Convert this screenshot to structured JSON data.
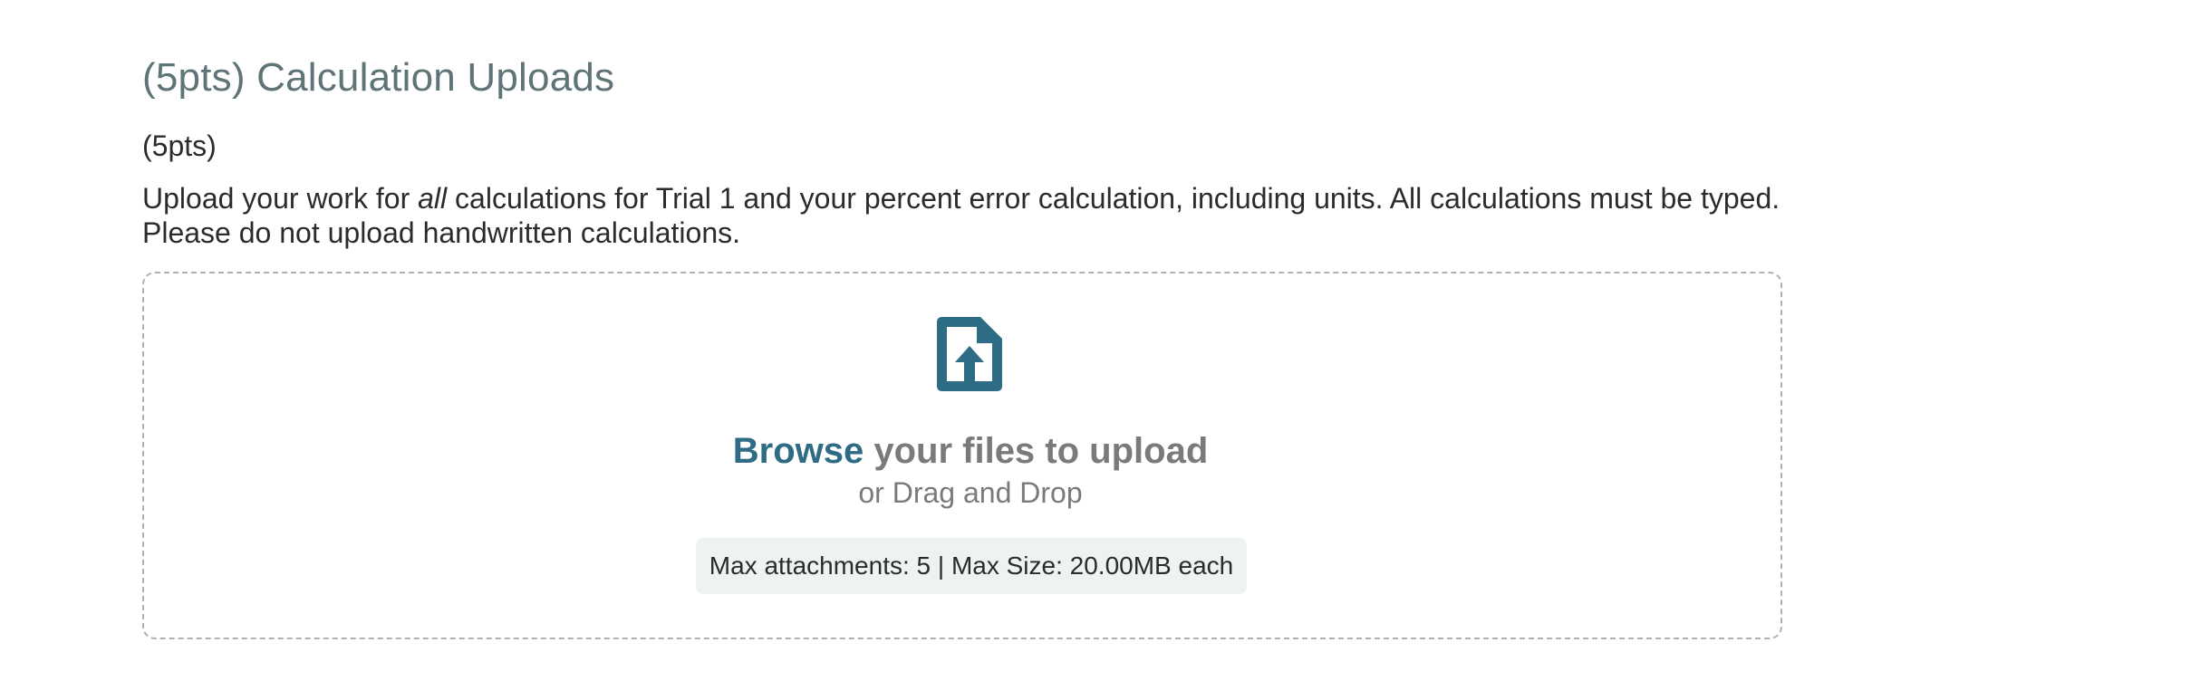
{
  "question": {
    "title": "(5pts) Calculation Uploads",
    "points": "(5pts)",
    "text_before": "Upload your work for ",
    "text_emphasis": "all",
    "text_after": " calculations for Trial 1 and your percent error calculation, including units. All calculations must be typed. Please do not upload handwritten calculations."
  },
  "upload": {
    "icon": "file-upload-icon",
    "browse_label": "Browse",
    "browse_rest": " your files to upload",
    "drag_drop_label": "or Drag and Drop",
    "limits_text": "Max attachments: 5 | Max Size: 20.00MB each"
  },
  "colors": {
    "title": "#5f7476",
    "accent": "#2e6b84",
    "muted": "#7a7a7a",
    "limits_bg": "#eef2f2"
  }
}
